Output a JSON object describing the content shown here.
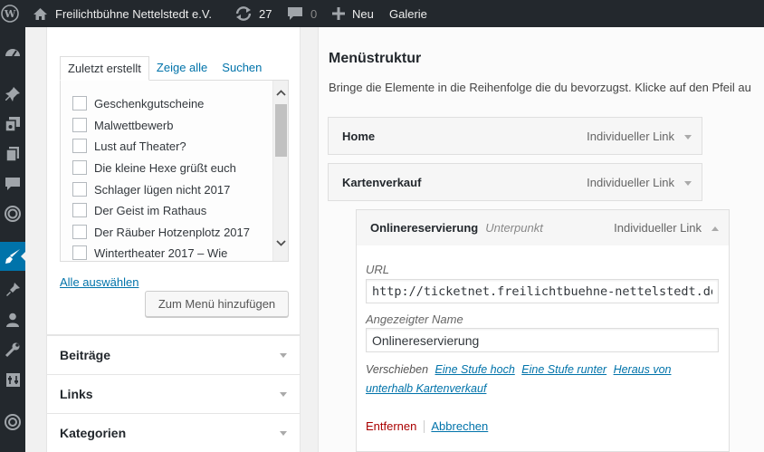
{
  "adminbar": {
    "site_name": "Freilichtbühne Nettelstedt e.V.",
    "updates_count": "27",
    "comments_count": "0",
    "new_label": "Neu",
    "gallery_label": "Galerie"
  },
  "left_panel": {
    "tabs": [
      "Zuletzt erstellt",
      "Zeige alle",
      "Suchen"
    ],
    "items": [
      "Geschenkgutscheine",
      "Malwettbewerb",
      "Lust auf Theater?",
      "Die kleine Hexe grüßt euch",
      "Schlager lügen nicht 2017",
      "Der Geist im Rathaus",
      "Der Räuber Hotzenplotz 2017",
      "Wintertheater 2017 – Wie"
    ],
    "select_all": "Alle auswählen",
    "add_button": "Zum Menü hinzufügen",
    "sections": [
      "Beiträge",
      "Links",
      "Kategorien"
    ]
  },
  "right_panel": {
    "heading": "Menüstruktur",
    "description": "Bringe die Elemente in die Reihenfolge die du bevorzugst. Klicke auf den Pfeil au",
    "items": [
      {
        "title": "Home",
        "type": "Individueller Link"
      },
      {
        "title": "Kartenverkauf",
        "type": "Individueller Link"
      },
      {
        "title": "Onlinereservierung",
        "subtitle": "Unterpunkt",
        "type": "Individueller Link"
      }
    ],
    "url_label": "URL",
    "url_value": "http://ticketnet.freilichtbuehne-nettelstedt.de/",
    "name_label": "Angezeigter Name",
    "name_value": "Onlinereservierung",
    "move_label": "Verschieben",
    "move_links": [
      "Eine Stufe hoch",
      "Eine Stufe runter",
      "Heraus von unterhalb Kartenverkauf"
    ],
    "remove_label": "Entfernen",
    "cancel_label": "Abbrechen"
  },
  "colors": {
    "adminbar_bg": "#23282d",
    "accent": "#0073aa",
    "remove": "#aa0000"
  }
}
